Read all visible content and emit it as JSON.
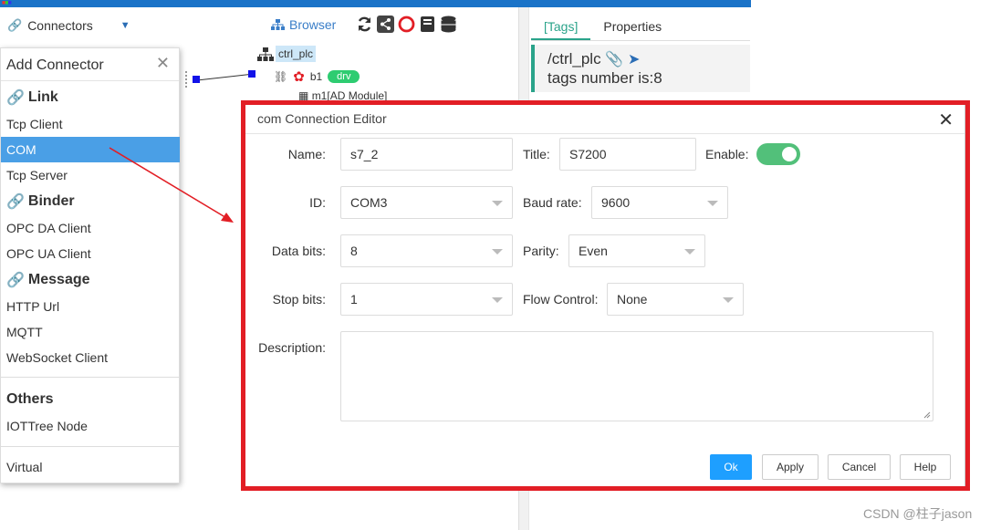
{
  "toolbar": {
    "connectors_label": "Connectors",
    "browser_label": "Browser"
  },
  "tree": {
    "root_label": "ctrl_plc",
    "b1_label": "b1",
    "b1_badge": "drv",
    "m1_label": "m1[AD Module]"
  },
  "right_panel": {
    "tabs": [
      {
        "label": "[Tags]"
      },
      {
        "label": "Properties"
      }
    ],
    "path": "/ctrl_plc",
    "tags_text": "tags number is:8"
  },
  "menu": {
    "title": "Add Connector",
    "groups": {
      "link": "Link",
      "binder": "Binder",
      "message": "Message",
      "others": "Others"
    },
    "items": {
      "tcp_client": "Tcp Client",
      "com": "COM",
      "tcp_server": "Tcp Server",
      "opc_da": "OPC DA Client",
      "opc_ua": "OPC UA Client",
      "http_url": "HTTP Url",
      "mqtt": "MQTT",
      "websocket": "WebSocket Client",
      "iottree_node": "IOTTree Node",
      "virtual": "Virtual"
    }
  },
  "dialog": {
    "title": "com Connection Editor",
    "name_label": "Name:",
    "name_value": "s7_2",
    "title_label": "Title:",
    "title_value": "S7200",
    "enable_label": "Enable:",
    "enable_on": true,
    "id_label": "ID:",
    "id_value": "COM3",
    "baud_label": "Baud rate:",
    "baud_value": "9600",
    "databits_label": "Data bits:",
    "databits_value": "8",
    "parity_label": "Parity:",
    "parity_value": "Even",
    "stopbits_label": "Stop bits:",
    "stopbits_value": "1",
    "flow_label": "Flow Control:",
    "flow_value": "None",
    "desc_label": "Description:",
    "buttons": {
      "ok": "Ok",
      "apply": "Apply",
      "cancel": "Cancel",
      "help": "Help"
    }
  },
  "colors": {
    "accent": "#2aa38a",
    "selected": "#4a9fe6",
    "highlight_frame": "#e21e25",
    "primary_button": "#1e9fff",
    "toggle_on": "#52c07a"
  },
  "watermark": "CSDN @柱子jason"
}
